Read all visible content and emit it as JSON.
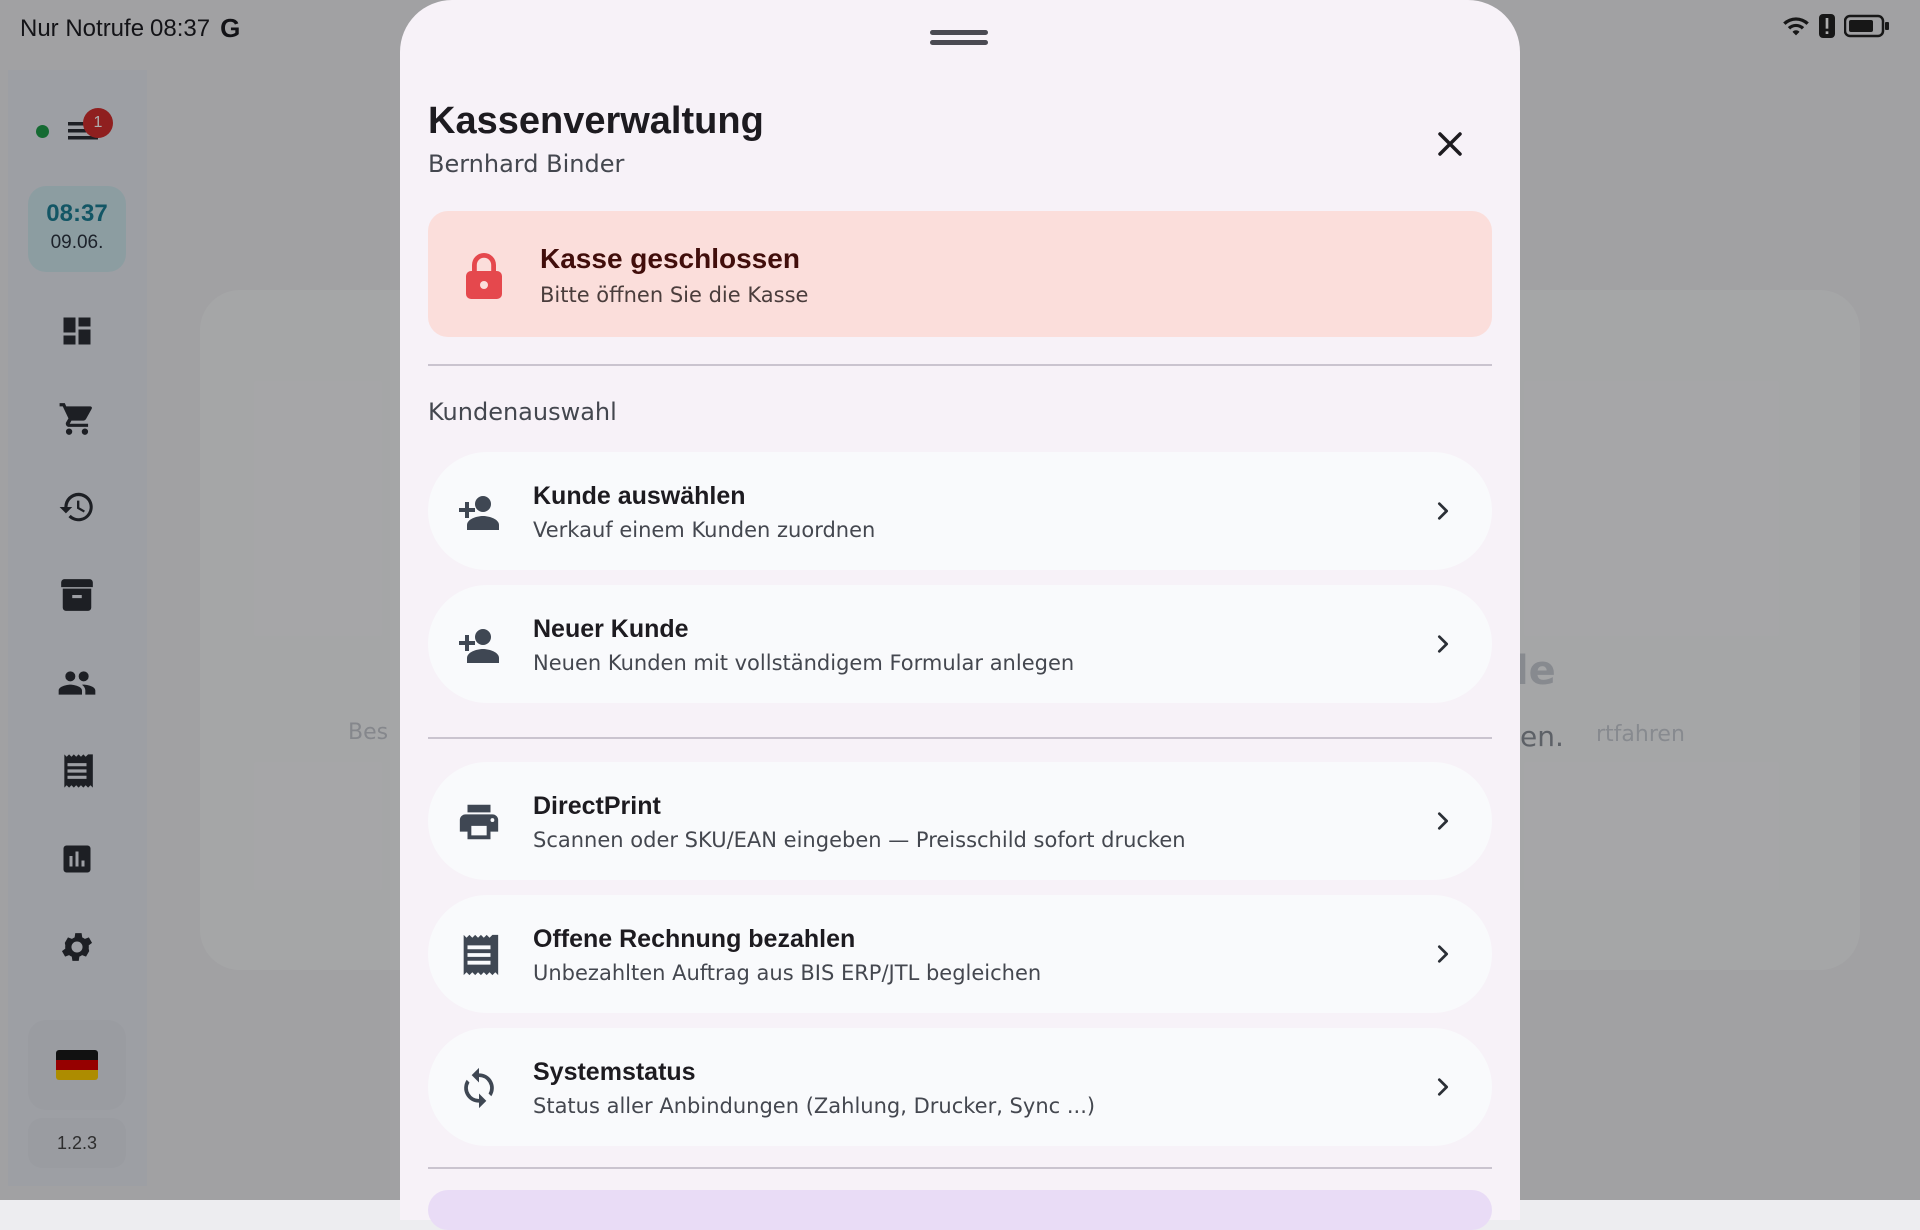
{
  "status_bar": {
    "carrier": "Nur Notrufe",
    "time": "08:37",
    "g_logo": "G",
    "icons": [
      "wifi-icon",
      "alert-icon",
      "battery-icon"
    ]
  },
  "rail": {
    "notification_count": "1",
    "clock_time": "08:37",
    "clock_date": "09.06.",
    "nav_icons": [
      "dashboard-icon",
      "cart-icon",
      "history-icon",
      "archive-icon",
      "customers-icon",
      "receipt-icon",
      "stats-icon",
      "settings-icon"
    ],
    "flag": "de-flag",
    "version": "1.2.3"
  },
  "background": {
    "title_fragment": "de",
    "sub_left_fragment": "Bes",
    "sub_right_fragment": "en.",
    "sub_right_fragment2": "rtfahren"
  },
  "sheet": {
    "title": "Kassenverwaltung",
    "subtitle": "Bernhard Binder",
    "alert": {
      "title": "Kasse geschlossen",
      "subtitle": "Bitte öffnen Sie die Kasse"
    },
    "section_label": "Kundenauswahl",
    "items": [
      {
        "title": "Kunde auswählen",
        "subtitle": "Verkauf einem Kunden zuordnen",
        "icon": "person-add-icon"
      },
      {
        "title": "Neuer Kunde",
        "subtitle": "Neuen Kunden mit vollständigem Formular anlegen",
        "icon": "person-add-icon"
      },
      {
        "title": "DirectPrint",
        "subtitle": "Scannen oder SKU/EAN eingeben — Preisschild sofort drucken",
        "icon": "printer-icon"
      },
      {
        "title": "Offene Rechnung bezahlen",
        "subtitle": "Unbezahlten Auftrag aus BIS ERP/JTL begleichen",
        "icon": "receipt-icon"
      },
      {
        "title": "Systemstatus",
        "subtitle": "Status aller Anbindungen (Zahlung, Drucker, Sync ...)",
        "icon": "sync-icon"
      }
    ]
  },
  "colors": {
    "alert_bg": "#fbdedb",
    "lock": "#e5484d",
    "accent_clock": "#1c7f95",
    "badge": "#d32f2f"
  }
}
